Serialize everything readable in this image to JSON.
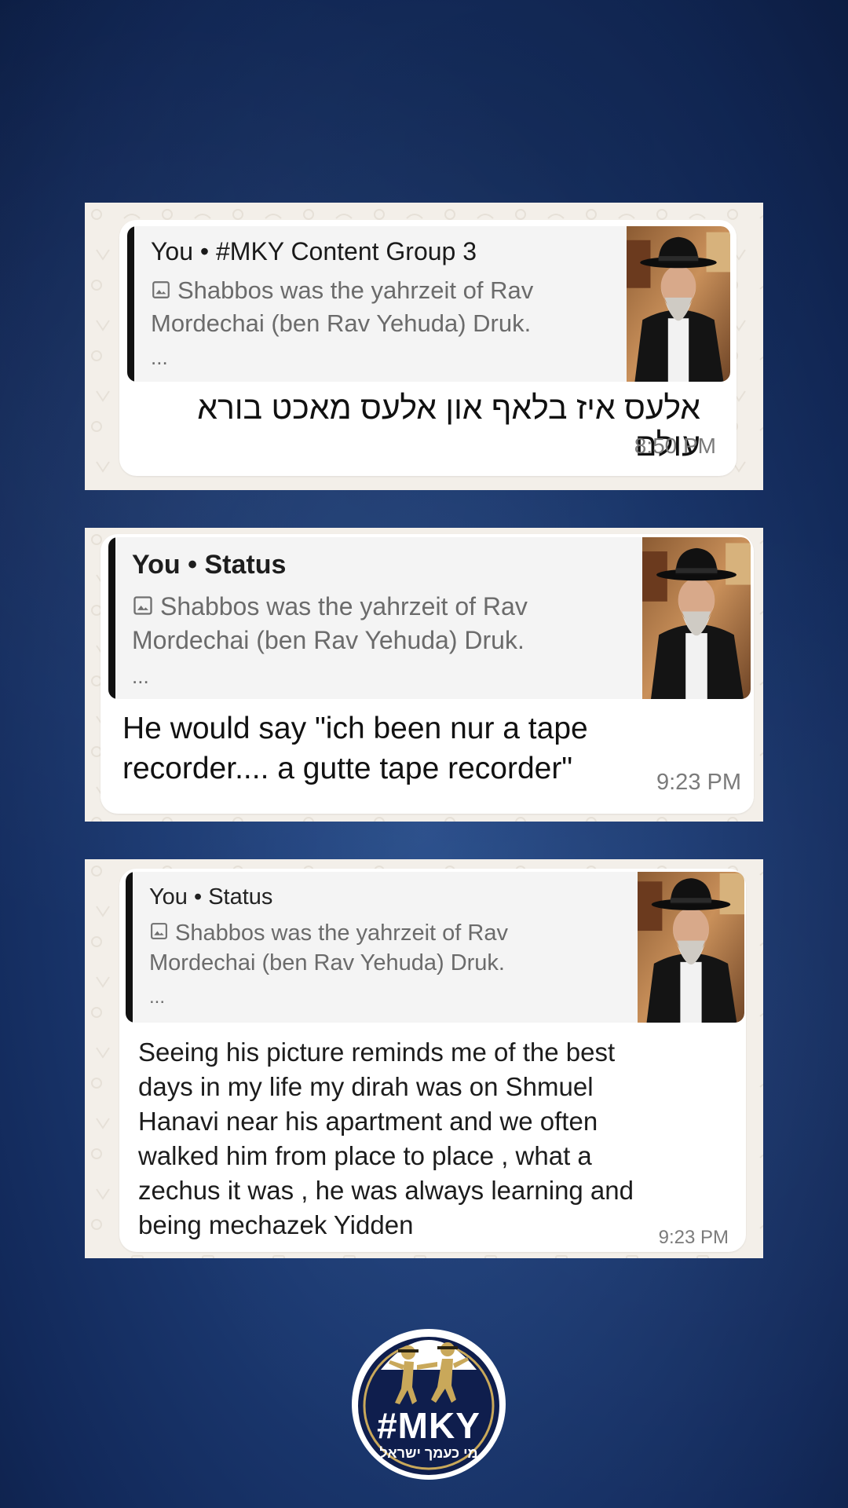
{
  "cards": [
    {
      "quote_header": "You • #MKY Content Group 3",
      "quote_snippet_line1": "Shabbos was the yahrzeit of Rav",
      "quote_snippet_line2": "Mordechai (ben Rav Yehuda) Druk.",
      "quote_ellipsis": "...",
      "message": "אלעס איז בלאף און אלעס מאכט בורא עולם",
      "time": "8:50 PM",
      "thumbnail_icon": "rabbi-photo-icon",
      "snippet_icon": "image-icon"
    },
    {
      "quote_header": "You • Status",
      "quote_snippet_line1": "Shabbos was the yahrzeit of Rav",
      "quote_snippet_line2": "Mordechai (ben Rav Yehuda) Druk.",
      "quote_ellipsis": "...",
      "message_line1": "He would say \"ich been nur a tape",
      "message_line2": "recorder.... a gutte tape recorder\"",
      "time": "9:23 PM",
      "thumbnail_icon": "rabbi-photo-icon",
      "snippet_icon": "image-icon"
    },
    {
      "quote_header": "You • Status",
      "quote_snippet_line1": "Shabbos was the yahrzeit of Rav",
      "quote_snippet_line2": "Mordechai (ben Rav Yehuda) Druk.",
      "quote_ellipsis": "...",
      "message_lines": [
        "Seeing his picture reminds me of the best",
        "days in my life my dirah was on Shmuel",
        "Hanavi near his apartment and we often",
        "walked him from place to place , what a",
        "zechus it was , he was always learning and",
        "being mechazek Yidden"
      ],
      "time": "9:23 PM",
      "thumbnail_icon": "rabbi-photo-icon",
      "snippet_icon": "image-icon"
    }
  ],
  "logo": {
    "name": "#MKY",
    "tagline": "מי כעמך ישראל",
    "icon": "mky-logo-icon"
  },
  "colors": {
    "background": "#1c3a72",
    "card": "#f3efe9",
    "bubble": "#ffffff",
    "quote_bar": "#111111",
    "logo_gold": "#c9a85a"
  }
}
